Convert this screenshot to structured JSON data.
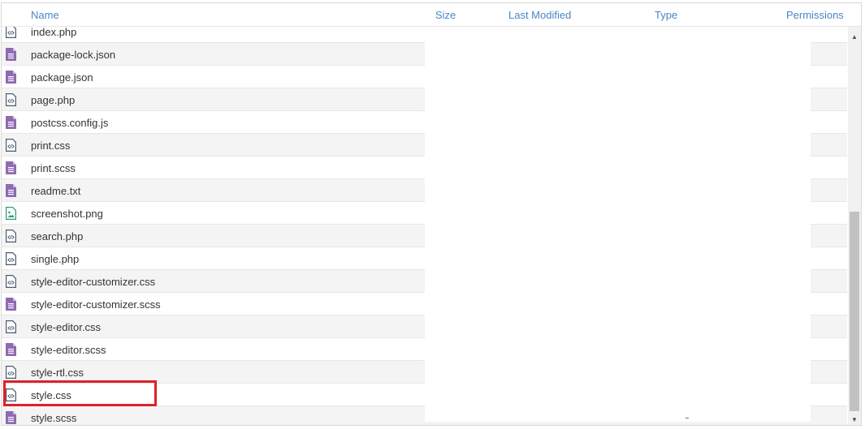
{
  "columns": {
    "name": "Name",
    "size": "Size",
    "last_modified": "Last Modified",
    "type": "Type",
    "permissions": "Permissions"
  },
  "files": [
    {
      "name": "index.php",
      "icon": "code-file-icon"
    },
    {
      "name": "package-lock.json",
      "icon": "text-file-icon"
    },
    {
      "name": "package.json",
      "icon": "text-file-icon"
    },
    {
      "name": "page.php",
      "icon": "code-file-icon"
    },
    {
      "name": "postcss.config.js",
      "icon": "text-file-icon"
    },
    {
      "name": "print.css",
      "icon": "code-file-icon"
    },
    {
      "name": "print.scss",
      "icon": "text-file-icon"
    },
    {
      "name": "readme.txt",
      "icon": "text-file-icon"
    },
    {
      "name": "screenshot.png",
      "icon": "image-file-icon"
    },
    {
      "name": "search.php",
      "icon": "code-file-icon"
    },
    {
      "name": "single.php",
      "icon": "code-file-icon"
    },
    {
      "name": "style-editor-customizer.css",
      "icon": "code-file-icon"
    },
    {
      "name": "style-editor-customizer.scss",
      "icon": "text-file-icon"
    },
    {
      "name": "style-editor.css",
      "icon": "code-file-icon"
    },
    {
      "name": "style-editor.scss",
      "icon": "text-file-icon"
    },
    {
      "name": "style-rtl.css",
      "icon": "code-file-icon"
    },
    {
      "name": "style.css",
      "icon": "code-file-icon"
    },
    {
      "name": "style.scss",
      "icon": "text-file-icon"
    }
  ],
  "highlighted_file": "style.css",
  "colors": {
    "header_text": "#4a86c5",
    "text_file_icon": "#8e6bb0",
    "code_file_icon": "#4a5b6e",
    "image_file_icon": "#2c9b79",
    "highlight_border": "#e0202a"
  }
}
